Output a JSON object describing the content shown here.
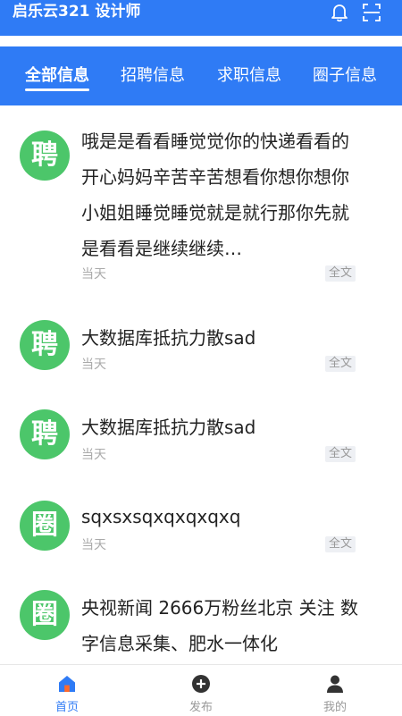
{
  "header": {
    "title": "启乐云321 设计师",
    "bell_icon": "bell-icon",
    "scan_icon": "scan-icon",
    "bg_color": "#2f7bf5"
  },
  "tabs": [
    {
      "label": "全部信息",
      "active": true
    },
    {
      "label": "招聘信息",
      "active": false
    },
    {
      "label": "求职信息",
      "active": false
    },
    {
      "label": "圈子信息",
      "active": false
    }
  ],
  "items": [
    {
      "avatar": "聘",
      "text": "哦是是看看睡觉觉你的快递看看的开心妈妈辛苦辛苦想看你想你想你小姐姐睡觉睡觉就是就行那你先就是看看是继续继续…",
      "date": "当天",
      "full": "全文"
    },
    {
      "avatar": "聘",
      "text": "大数据库抵抗力散sad",
      "date": "当天",
      "full": "全文"
    },
    {
      "avatar": "聘",
      "text": "大数据库抵抗力散sad",
      "date": "当天",
      "full": "全文"
    },
    {
      "avatar": "圈",
      "text": "sqxsxsqxqxqxqxq",
      "date": "当天",
      "full": "全文"
    },
    {
      "avatar": "圈",
      "text": "央视新闻 2666万粉丝北京 关注 数字信息采集、肥水一体化",
      "date": "",
      "full": ""
    }
  ],
  "nav": [
    {
      "label": "首页",
      "icon": "home-icon",
      "active": true
    },
    {
      "label": "发布",
      "icon": "plus-circle-icon",
      "active": false
    },
    {
      "label": "我的",
      "icon": "user-icon",
      "active": false
    }
  ],
  "avatar_color": "#4cc66a"
}
